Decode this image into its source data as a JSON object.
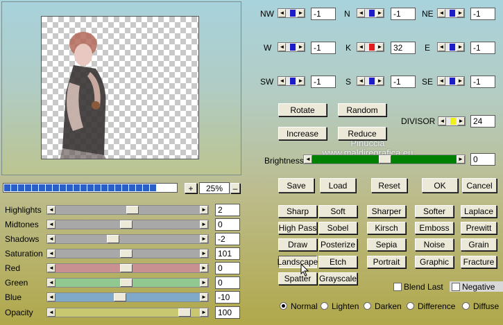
{
  "zoom": {
    "plus": "+",
    "value": "25%",
    "minus": "–"
  },
  "progress_segments": 22,
  "watermark": "Pinuccia\nwww.maldiregrafica.eu",
  "directions": [
    {
      "label": "NW",
      "value": "-1",
      "color": "#1c1cc8"
    },
    {
      "label": "N",
      "value": "-1",
      "color": "#1c1cc8"
    },
    {
      "label": "NE",
      "value": "-1",
      "color": "#1c1cc8"
    },
    {
      "label": "W",
      "value": "-1",
      "color": "#1c1cc8"
    },
    {
      "label": "K",
      "value": "32",
      "color": "#e01c1c"
    },
    {
      "label": "E",
      "value": "-1",
      "color": "#1c1cc8"
    },
    {
      "label": "SW",
      "value": "-1",
      "color": "#1c1cc8"
    },
    {
      "label": "S",
      "value": "-1",
      "color": "#1c1cc8"
    },
    {
      "label": "SE",
      "value": "-1",
      "color": "#1c1cc8"
    }
  ],
  "buttons": {
    "rotate": "Rotate",
    "random": "Random",
    "increase": "Increase",
    "reduce": "Reduce",
    "save": "Save",
    "load": "Load",
    "reset": "Reset",
    "ok": "OK",
    "cancel": "Cancel"
  },
  "divisor": {
    "label": "DIVISOR",
    "value": "24",
    "color": "#f0f01c"
  },
  "brightness": {
    "label": "Brightness",
    "value": "0"
  },
  "adjust": [
    {
      "label": "Highlights",
      "value": "2",
      "track": "#a8a8a8",
      "pos": 0.55
    },
    {
      "label": "Midtones",
      "value": "0",
      "track": "#a8a8a8",
      "pos": 0.5
    },
    {
      "label": "Shadows",
      "value": "-2",
      "track": "#a8a8a8",
      "pos": 0.4
    },
    {
      "label": "Saturation",
      "value": "101",
      "track": "#a8a8a8",
      "pos": 0.5
    },
    {
      "label": "Red",
      "value": "0",
      "track": "#c89090",
      "pos": 0.5
    },
    {
      "label": "Green",
      "value": "0",
      "track": "#90c890",
      "pos": 0.5
    },
    {
      "label": "Blue",
      "value": "-10",
      "track": "#80a8c8",
      "pos": 0.45
    },
    {
      "label": "Opacity",
      "value": "100",
      "track": "#c8c870",
      "pos": 0.95
    }
  ],
  "filters": [
    "Sharp",
    "Soft",
    "Sharper",
    "Softer",
    "Laplace",
    "High Pass",
    "Sobel",
    "Kirsch",
    "Emboss",
    "Prewitt",
    "Draw",
    "Posterize",
    "Sepia",
    "Noise",
    "Grain",
    "Landscape",
    "Etch",
    "Portrait",
    "Graphic",
    "Fracture",
    "Spatter",
    "Grayscale"
  ],
  "checks": {
    "blend_last": "Blend Last",
    "negative": "Negative"
  },
  "modes": [
    "Normal",
    "Lighten",
    "Darken",
    "Difference",
    "Diffuse"
  ]
}
